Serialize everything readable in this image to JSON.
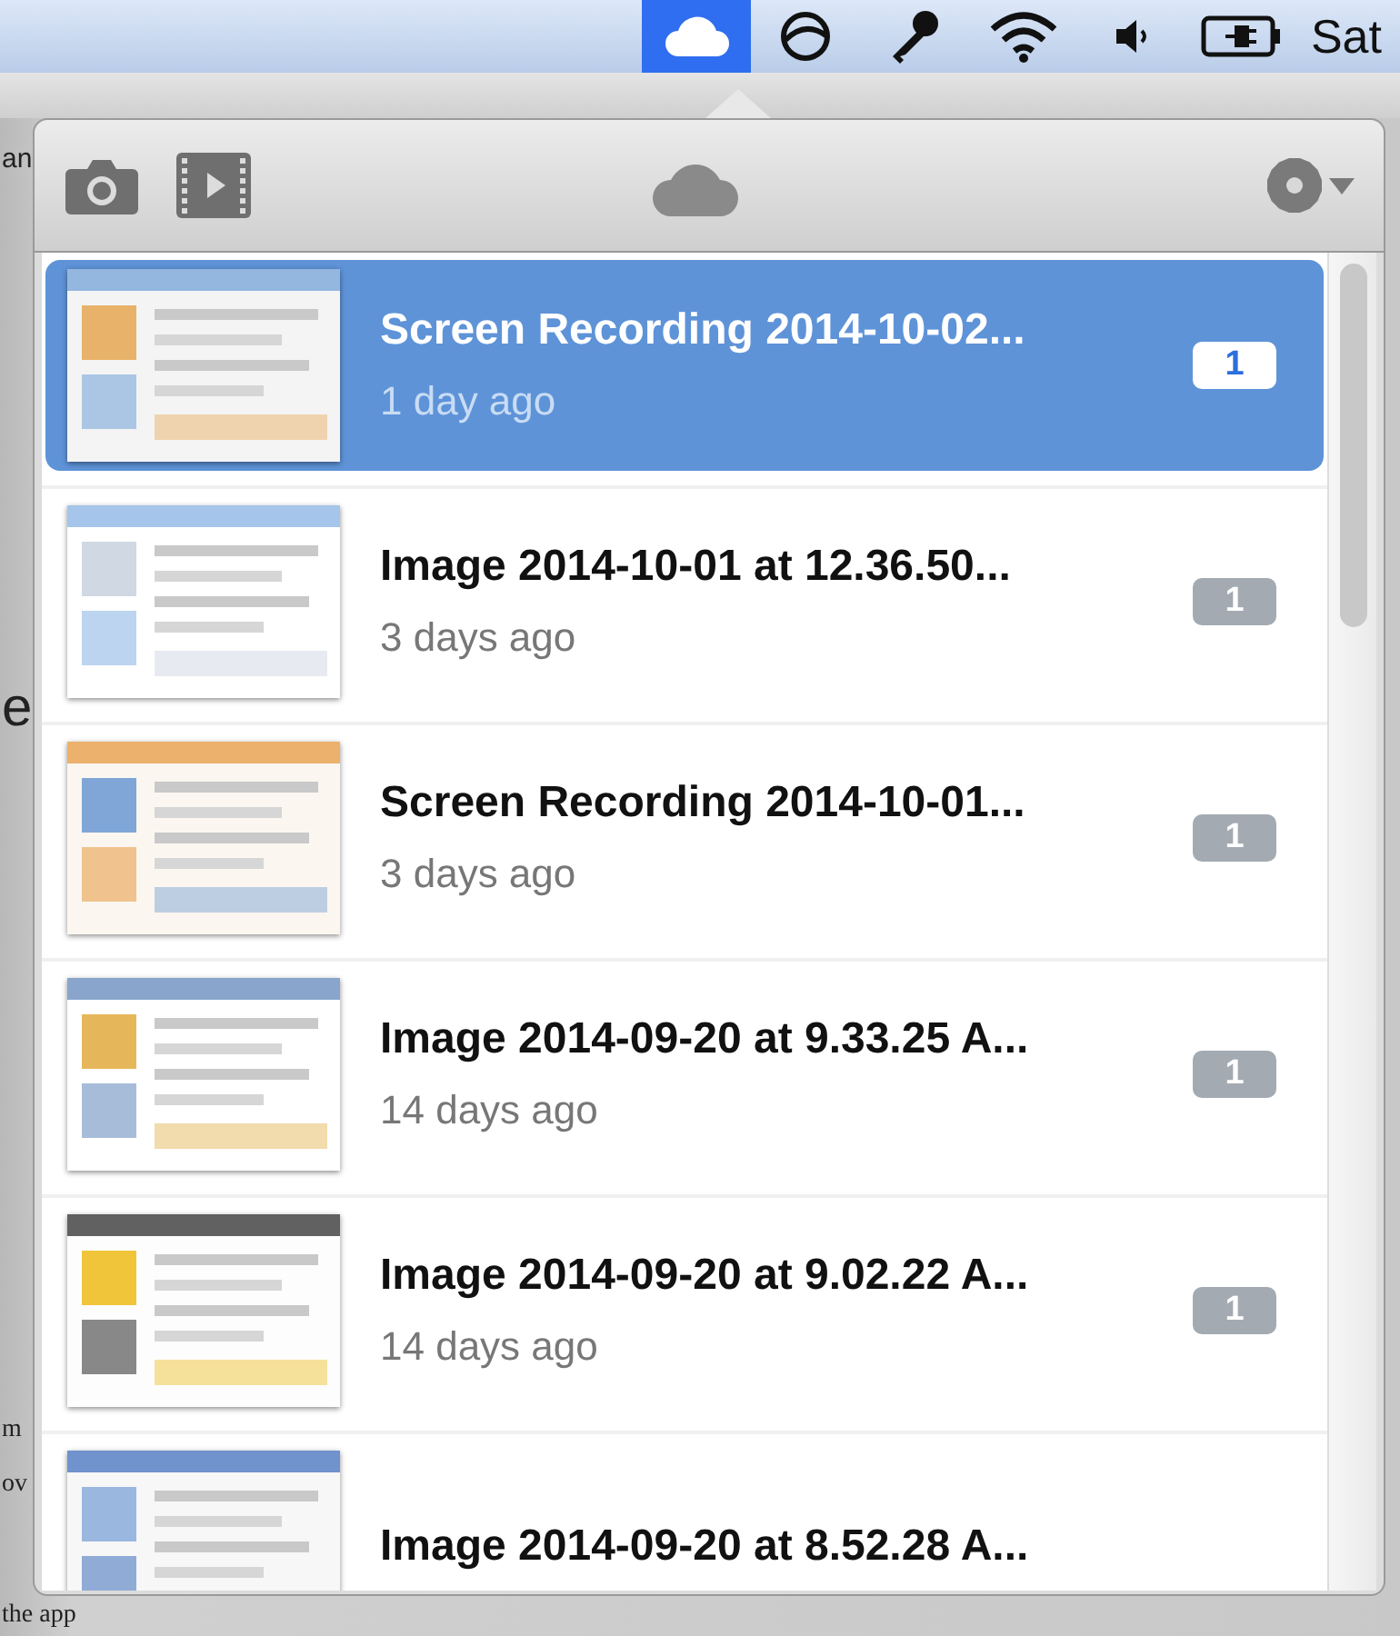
{
  "menu_bar": {
    "items": [
      {
        "selected": true
      },
      {
        "selected": false
      },
      {
        "selected": false
      },
      {
        "selected": false
      },
      {
        "selected": false
      },
      {
        "selected": false
      }
    ],
    "clock": "Sat"
  },
  "background_text": [
    {
      "text": "an",
      "kind": "label"
    },
    {
      "text": "e",
      "kind": "heading"
    },
    {
      "text": "m",
      "kind": "body"
    },
    {
      "text": "ov",
      "kind": "body"
    },
    {
      "text": "the app",
      "kind": "body"
    }
  ],
  "items": [
    {
      "title": "Screen Recording 2014-10-02...",
      "age": "1 day ago",
      "count": "1",
      "selected": true
    },
    {
      "title": "Image 2014-10-01 at 12.36.50...",
      "age": "3 days ago",
      "count": "1",
      "selected": false
    },
    {
      "title": "Screen Recording 2014-10-01...",
      "age": "3 days ago",
      "count": "1",
      "selected": false
    },
    {
      "title": "Image 2014-09-20 at 9.33.25 A...",
      "age": "14 days ago",
      "count": "1",
      "selected": false
    },
    {
      "title": "Image 2014-09-20 at 9.02.22 A...",
      "age": "14 days ago",
      "count": "1",
      "selected": false
    },
    {
      "title": "Image 2014-09-20 at 8.52.28 A...",
      "selected": false
    }
  ]
}
